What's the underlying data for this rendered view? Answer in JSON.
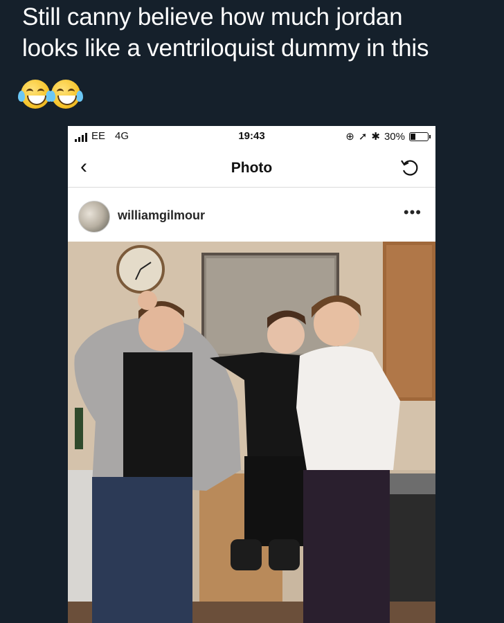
{
  "tweet": {
    "line1": "Still canny believe how much jordan",
    "line2": "looks like a ventriloquist dummy in this",
    "emojis": [
      "face-with-tears-of-joy",
      "face-with-tears-of-joy"
    ]
  },
  "status_bar": {
    "carrier": "EE",
    "network": "4G",
    "time": "19:43",
    "battery": "30%",
    "battery_level": 0.3
  },
  "nav": {
    "title": "Photo"
  },
  "post": {
    "username": "williamgilmour"
  },
  "colors": {
    "background": "#15202b",
    "tweet_text": "#ffffff",
    "phone_bg": "#ffffff"
  }
}
